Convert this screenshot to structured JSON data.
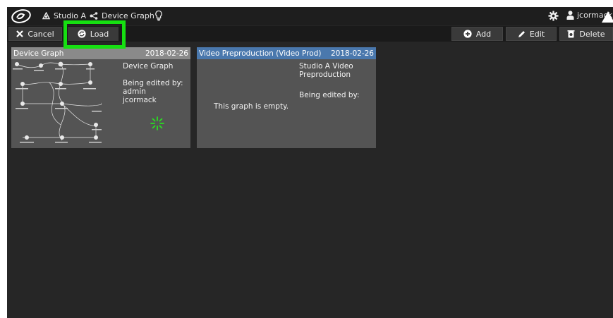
{
  "topbar": {
    "studio": "Studio A",
    "graph": "Device Graph",
    "user": "jcormack",
    "icons": [
      "logo-icon",
      "studio-icon",
      "graph-icon",
      "lightbulb-icon",
      "gear-icon",
      "user-icon",
      "alert-triangle-icon"
    ]
  },
  "toolbar": {
    "cancel": "Cancel",
    "load": "Load",
    "add": "Add",
    "edit": "Edit",
    "delete": "Delete"
  },
  "cards": [
    {
      "title": "Device Graph",
      "date": "2018-02-26",
      "name": "Device Graph",
      "edited_label": "Being edited by:",
      "editors": [
        "admin",
        "jcormack"
      ]
    },
    {
      "title": "Video Preproduction (Video Prod)",
      "date": "2018-02-26",
      "name_line1": "Studio A Video",
      "name_line2": "Preproduction",
      "edited_label": "Being edited by:",
      "empty": "This graph is empty."
    }
  ],
  "colors": {
    "accent_green": "#16e011",
    "card_header_selected": "#8a8a8a",
    "card_header": "#4a78ad",
    "card_body": "#545454"
  }
}
